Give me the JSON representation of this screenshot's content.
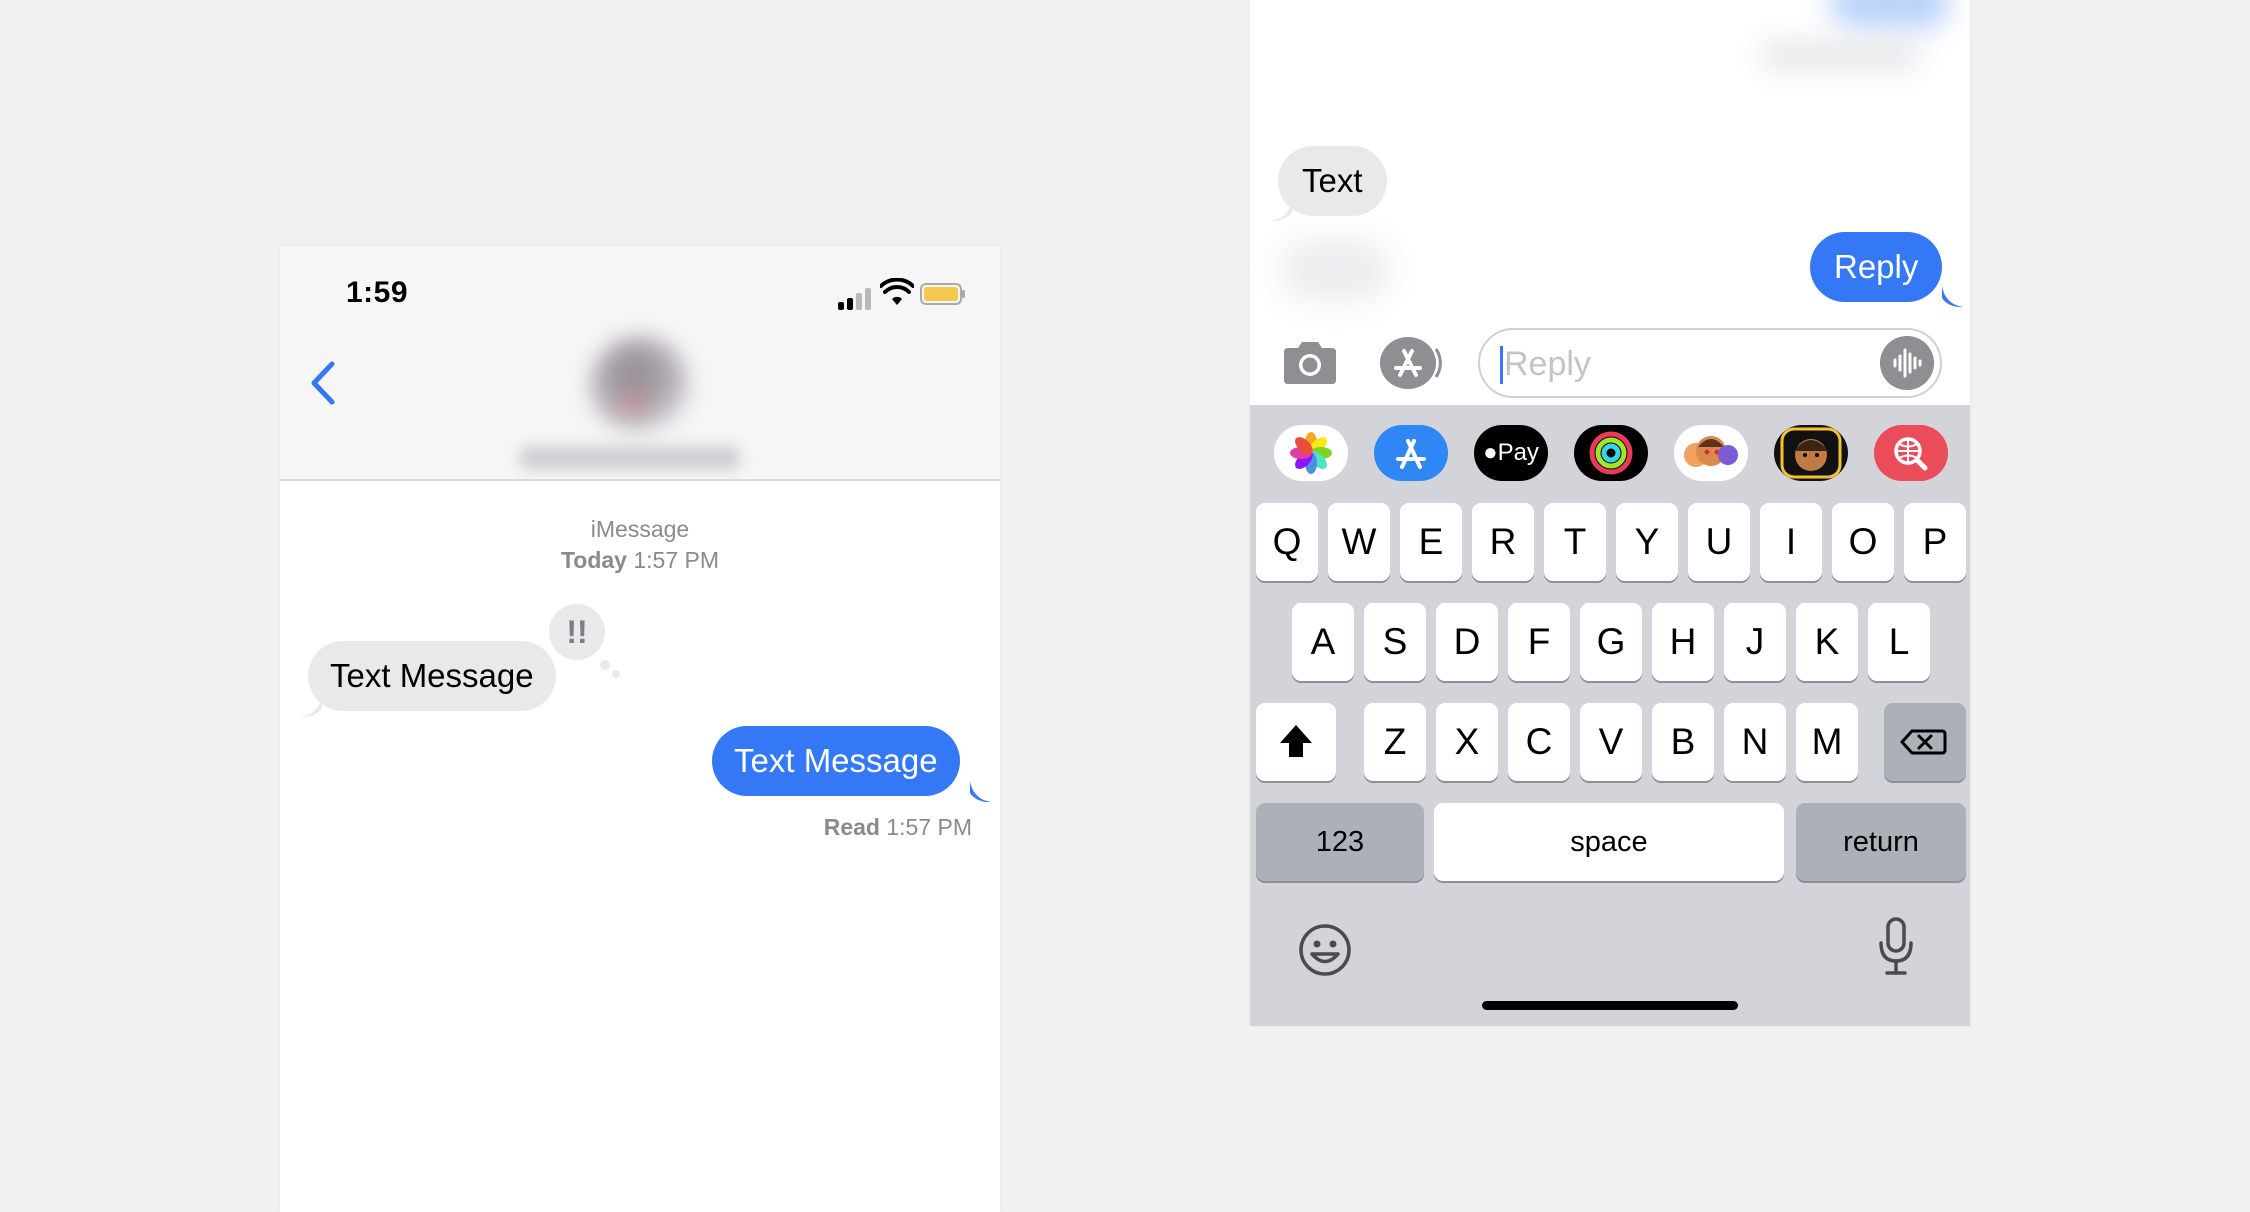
{
  "left_screen": {
    "status_bar": {
      "time": "1:59"
    },
    "service_label": "iMessage",
    "timestamp": {
      "day": "Today",
      "time": "1:57 PM"
    },
    "messages": [
      {
        "direction": "incoming",
        "text": "Text Message",
        "tapback": "!!"
      },
      {
        "direction": "outgoing",
        "text": "Text Message"
      }
    ],
    "read_receipt": {
      "label": "Read",
      "time": "1:57 PM"
    }
  },
  "right_screen": {
    "messages": [
      {
        "direction": "incoming",
        "text": "Text"
      },
      {
        "direction": "outgoing",
        "text": "Reply"
      }
    ],
    "compose": {
      "placeholder": "Reply"
    },
    "app_drawer": [
      "photos-icon",
      "app-store-icon",
      "apple-pay-icon",
      "activity-icon",
      "memoji-stickers-icon",
      "memoji-icon",
      "web-images-search-icon"
    ],
    "apple_pay_label": "Pay",
    "keyboard": {
      "row1": [
        "Q",
        "W",
        "E",
        "R",
        "T",
        "Y",
        "U",
        "I",
        "O",
        "P"
      ],
      "row2": [
        "A",
        "S",
        "D",
        "F",
        "G",
        "H",
        "J",
        "K",
        "L"
      ],
      "row3": [
        "Z",
        "X",
        "C",
        "V",
        "B",
        "N",
        "M"
      ],
      "numbers_key": "123",
      "space_key": "space",
      "return_key": "return"
    }
  },
  "colors": {
    "accent": "#3478f6",
    "incoming_bubble": "#e9e9eb",
    "keyboard_bg": "#d2d4da"
  }
}
